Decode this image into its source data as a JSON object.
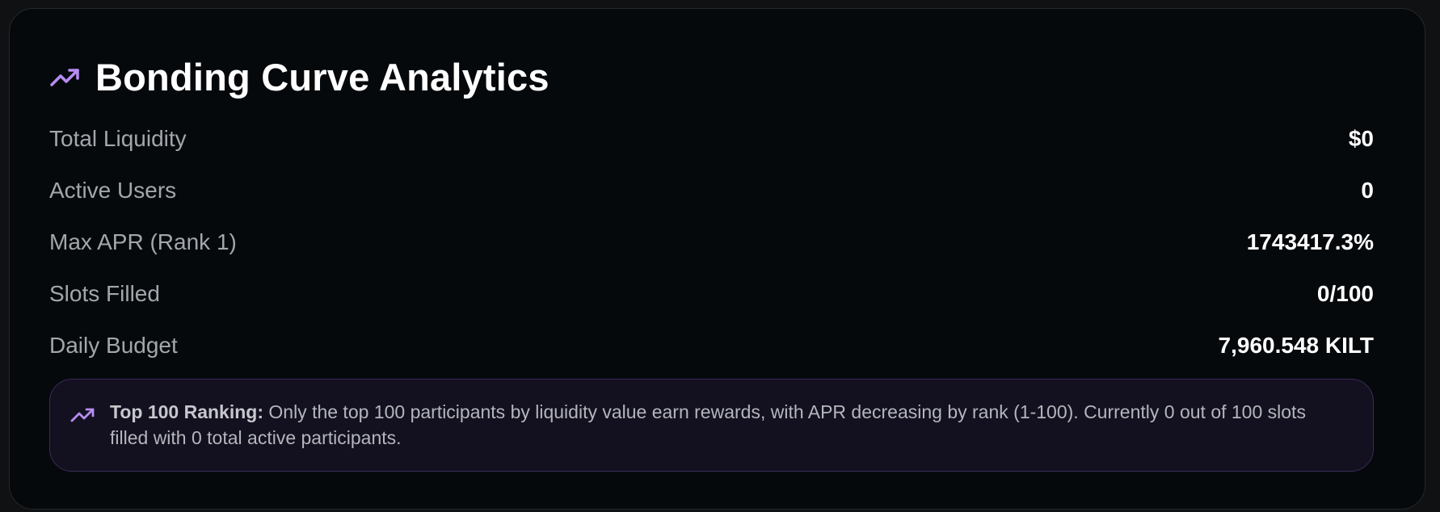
{
  "card": {
    "title": "Bonding Curve Analytics",
    "title_icon": "trending-up-icon",
    "accent_color": "#b58cf0"
  },
  "stats": [
    {
      "label": "Total Liquidity",
      "value": "$0"
    },
    {
      "label": "Active Users",
      "value": "0"
    },
    {
      "label": "Max APR (Rank 1)",
      "value": "1743417.3%"
    },
    {
      "label": "Slots Filled",
      "value": "0/100"
    },
    {
      "label": "Daily Budget",
      "value": "7,960.548 KILT"
    }
  ],
  "info": {
    "icon": "trending-up-icon",
    "heading": "Top 100 Ranking:",
    "text": " Only the top 100 participants by liquidity value earn rewards, with APR decreasing by rank (1-100). Currently 0 out of 100 slots filled with 0 total active participants."
  }
}
